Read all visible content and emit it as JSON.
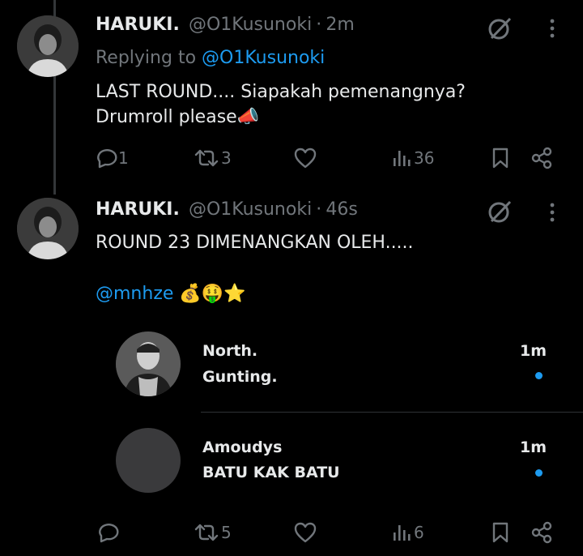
{
  "tweets": [
    {
      "name": "HARUKI.",
      "handle": "@O1Kusunoki",
      "time": "2m",
      "replying_prefix": "Replying to",
      "replying_to": "@O1Kusunoki",
      "text_line1": "LAST ROUND.... Siapakah pemenangnya?",
      "text_line2": "Drumroll please",
      "text_line2_emoji": "📣",
      "replies": "1",
      "retweets": "3",
      "likes": "",
      "views": "36"
    },
    {
      "name": "HARUKI.",
      "handle": "@O1Kusunoki",
      "time": "46s",
      "text_line1": "ROUND 23 DIMENANGKAN OLEH.....",
      "mention": "@mnhze",
      "emojis": "💰🤑⭐",
      "replies": "",
      "retweets": "5",
      "likes": "",
      "views": "6"
    }
  ],
  "sep": "·",
  "embedded_replies": [
    {
      "name": "North.",
      "text": "Gunting.",
      "time": "1m"
    },
    {
      "name": "Amoudys",
      "text": "BATU KAK BATU",
      "time": "1m"
    }
  ],
  "colors": {
    "accent": "#1d9bf0",
    "muted": "#71767b",
    "text": "#e7e9ea",
    "background": "#000000"
  }
}
